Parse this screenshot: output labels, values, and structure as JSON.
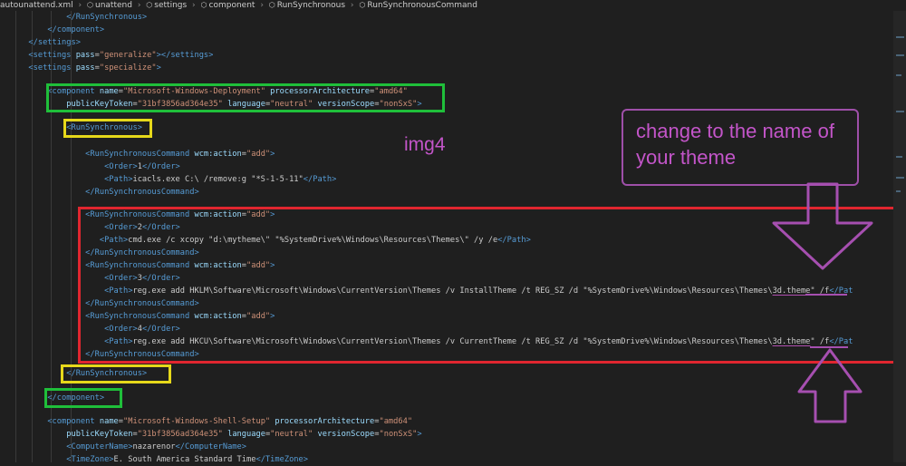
{
  "breadcrumb": {
    "file": "autounattend.xml",
    "items": [
      "unattend",
      "settings",
      "component",
      "RunSynchronous",
      "RunSynchronousCommand"
    ]
  },
  "code": {
    "l01": "</RunSynchronous>",
    "l02": "</component>",
    "l03": "</settings>",
    "l04_tag": "<settings ",
    "l04_attr": "pass",
    "l04_val": "\"generalize\"",
    "l04_end": "></settings>",
    "l05_tag": "<settings ",
    "l05_attr": "pass",
    "l05_val": "\"specialize\"",
    "l05_end": ">",
    "l06_tag": "<component ",
    "l06_a1": "name",
    "l06_v1": "\"Microsoft-Windows-Deployment\"",
    "l06_a2": " processorArchitecture",
    "l06_v2": "\"amd64\"",
    "l07_a1": "publicKeyToken",
    "l07_v1": "\"31bf3856ad364e35\"",
    "l07_a2": " language",
    "l07_v2": "\"neutral\"",
    "l07_a3": " versionScope",
    "l07_v3": "\"nonSxS\"",
    "l07_end": ">",
    "l08": "<RunSynchronous>",
    "l09_tag": "<RunSynchronousCommand ",
    "l09_attr": "wcm:action",
    "l09_val": "\"add\"",
    "l10_o": "<Order>",
    "l10_v": "1",
    "l10_c": "</Order>",
    "l11_o": "<Path>",
    "l11_v": "icacls.exe C:\\ /remove:g \"*S-1-5-11\"",
    "l11_c": "</Path>",
    "l12": "</RunSynchronousCommand>",
    "l13_tag": "<RunSynchronousCommand ",
    "l13_attr": "wcm:action",
    "l13_val": "\"add\"",
    "l14_o": "<Order>",
    "l14_v": "2",
    "l14_c": "</Order>",
    "l15_o": "<Path>",
    "l15_v": "cmd.exe /c xcopy \"d:\\mytheme\\\" \"%SystemDrive%\\Windows\\Resources\\Themes\\\" /y /e",
    "l15_c": "</Path>",
    "l16": "</RunSynchronousCommand>",
    "l17_tag": "<RunSynchronousCommand ",
    "l17_attr": "wcm:action",
    "l17_val": "\"add\"",
    "l18_o": "<Order>",
    "l18_v": "3",
    "l18_c": "</Order>",
    "l19_o": "<Path>",
    "l19_v": "reg.exe add HKLM\\Software\\Microsoft\\Windows\\CurrentVersion\\Themes /v InstallTheme /t REG_SZ /d \"%SystemDrive%\\Windows\\Resources\\Themes\\",
    "l19_u": "3d.theme",
    "l19_q": "\" /f",
    "l19_c": "</Pat",
    "l20": "</RunSynchronousCommand>",
    "l21_tag": "<RunSynchronousCommand ",
    "l21_attr": "wcm:action",
    "l21_val": "\"add\"",
    "l22_o": "<Order>",
    "l22_v": "4",
    "l22_c": "</Order>",
    "l23_o": "<Path>",
    "l23_v": "reg.exe add HKCU\\Software\\Microsoft\\Windows\\CurrentVersion\\Themes /v CurrentTheme /t REG_SZ /d \"%SystemDrive%\\Windows\\Resources\\Themes\\",
    "l23_u": "3d.theme",
    "l23_q": "\" /f",
    "l23_c": "</Pat",
    "l24": "</RunSynchronousCommand>",
    "l25": "</RunSynchronous>",
    "l26": "</component>",
    "l27_tag": "<component ",
    "l27_a1": "name",
    "l27_v1": "\"Microsoft-Windows-Shell-Setup\"",
    "l27_a2": " processorArchitecture",
    "l27_v2": "\"amd64\"",
    "l28_a1": "publicKeyToken",
    "l28_v1": "\"31bf3856ad364e35\"",
    "l28_a2": " language",
    "l28_v2": "\"neutral\"",
    "l28_a3": " versionScope",
    "l28_v3": "\"nonSxS\"",
    "l28_end": ">",
    "l29_o": "<ComputerName>",
    "l29_v": "nazarenor",
    "l29_c": "</ComputerName>",
    "l30_o": "<TimeZone>",
    "l30_v": "E. South America Standard Time",
    "l30_c": "</TimeZone>"
  },
  "annotations": {
    "img_label": "img4",
    "callout_text": "change to the name of your theme",
    "colors": {
      "green": "#1fbf3a",
      "yellow": "#e6d81a",
      "red": "#e0262f",
      "purple": "#a64fb0"
    }
  }
}
